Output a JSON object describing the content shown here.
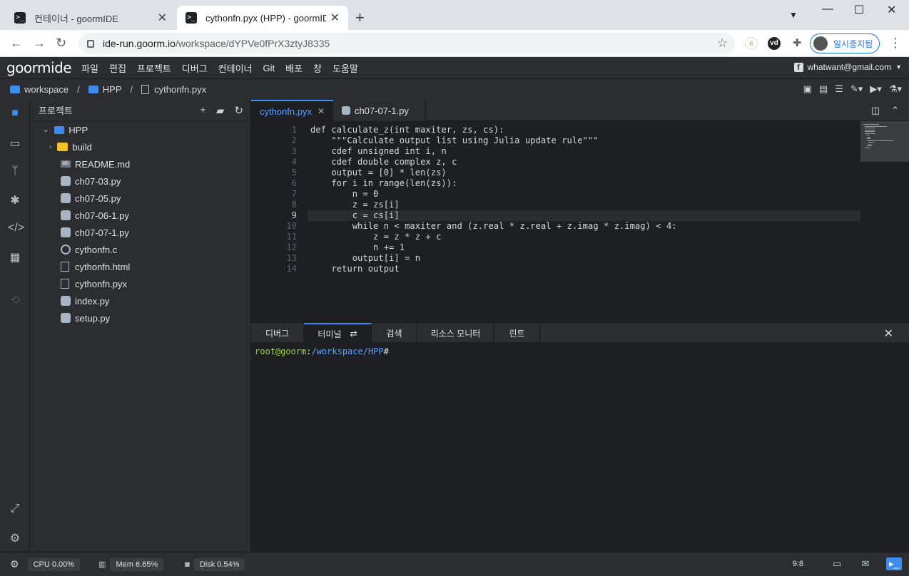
{
  "browser": {
    "tabs": [
      {
        "title": "컨테이너 - goormIDE",
        "active": false
      },
      {
        "title": "cythonfn.pyx (HPP) - goormIDE",
        "active": true
      }
    ],
    "url_host": "ide-run.goorm.io",
    "url_path": "/workspace/dYPVe0fPrX3ztyJ8335",
    "profile_label": "일시중지됨"
  },
  "ide": {
    "logo": "goormide",
    "menu": [
      "파일",
      "편집",
      "프로젝트",
      "디버그",
      "컨테이너",
      "Git",
      "배포",
      "창",
      "도움말"
    ],
    "user": "whatwant@gmail.com",
    "breadcrumb": [
      "workspace",
      "HPP",
      "cythonfn.pyx"
    ]
  },
  "explorer": {
    "title": "프로젝트",
    "root": "HPP",
    "items": [
      {
        "name": "build",
        "type": "folder"
      },
      {
        "name": "README.md",
        "type": "md"
      },
      {
        "name": "ch07-03.py",
        "type": "py"
      },
      {
        "name": "ch07-05.py",
        "type": "py"
      },
      {
        "name": "ch07-06-1.py",
        "type": "py"
      },
      {
        "name": "ch07-07-1.py",
        "type": "py"
      },
      {
        "name": "cythonfn.c",
        "type": "c"
      },
      {
        "name": "cythonfn.html",
        "type": "html"
      },
      {
        "name": "cythonfn.pyx",
        "type": "file"
      },
      {
        "name": "index.py",
        "type": "py"
      },
      {
        "name": "setup.py",
        "type": "py"
      }
    ]
  },
  "editor": {
    "tabs": [
      {
        "title": "cythonfn.pyx",
        "active": true
      },
      {
        "title": "ch07-07-1.py",
        "active": false
      }
    ],
    "current_line": 9,
    "lines": [
      "def calculate_z(int maxiter, zs, cs):",
      "    \"\"\"Calculate output list using Julia update rule\"\"\"",
      "    cdef unsigned int i, n",
      "    cdef double complex z, c",
      "    output = [0] * len(zs)",
      "    for i in range(len(zs)):",
      "        n = 0",
      "        z = zs[i]",
      "        c = cs[i]",
      "        while n < maxiter and (z.real * z.real + z.imag * z.imag) < 4:",
      "            z = z * z + c",
      "            n += 1",
      "        output[i] = n",
      "    return output"
    ]
  },
  "panel": {
    "tabs": [
      "디버그",
      "터미널",
      "검색",
      "리소스 모니터",
      "린트"
    ],
    "active_tab": "터미널",
    "prompt_user": "root@goorm",
    "prompt_colon": ":",
    "prompt_path": "/workspace/HPP",
    "prompt_symbol": "#"
  },
  "status": {
    "cpu": "CPU 0.00%",
    "mem": "Mem 6.65%",
    "disk": "Disk 0.54%",
    "cursor": "9:8"
  }
}
